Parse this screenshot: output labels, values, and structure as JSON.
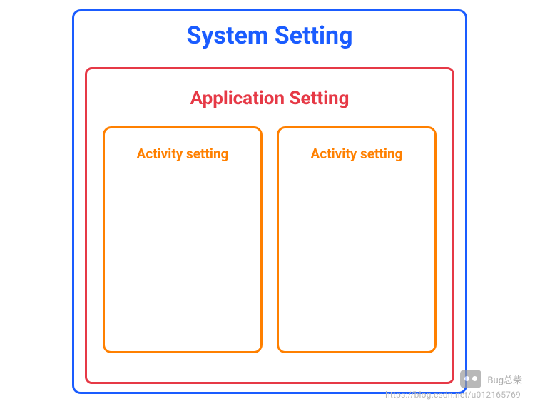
{
  "diagram": {
    "system": {
      "title": "System Setting",
      "color": "#1a5cff"
    },
    "application": {
      "title": "Application Setting",
      "color": "#e63946"
    },
    "activities": [
      {
        "title": "Activity setting"
      },
      {
        "title": "Activity setting"
      }
    ]
  },
  "watermark": {
    "label": "Bug总柴",
    "url": "https://blog.csdn.net/u012165769"
  }
}
